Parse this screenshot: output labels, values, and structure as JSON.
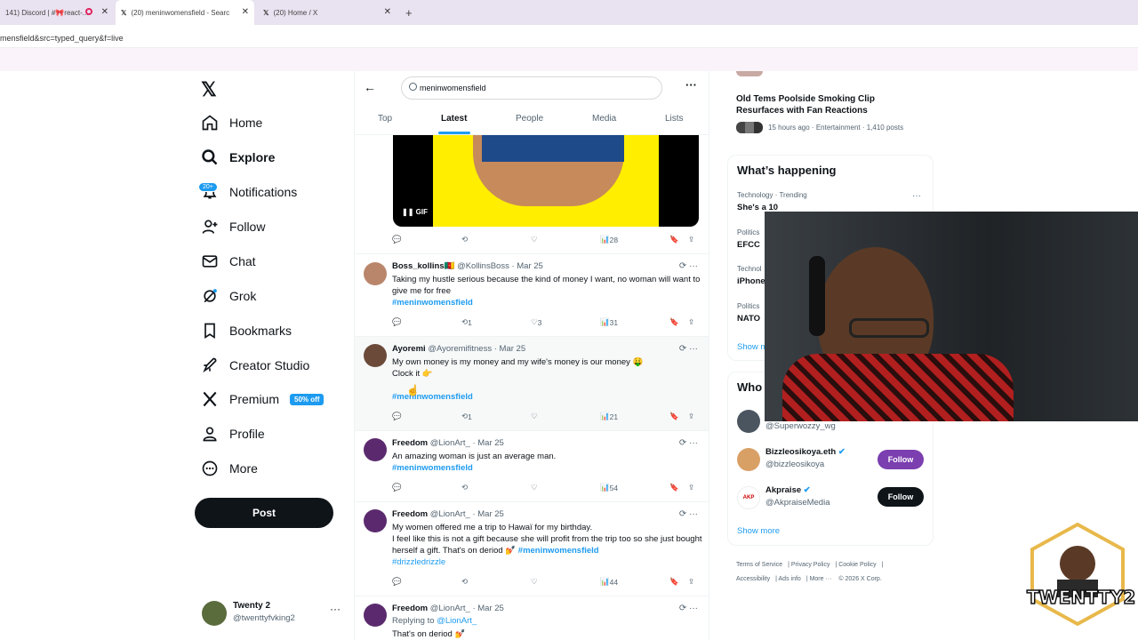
{
  "browser": {
    "tabs": [
      {
        "title": "141) Discord | #🎀react-..."
      },
      {
        "title": "(20) meninwomensfield - Searc"
      },
      {
        "title": "(20) Home / X"
      }
    ],
    "address": "mensfield&src=typed_query&f=live"
  },
  "sidebar": {
    "items": [
      {
        "label": "Home",
        "icon": "home-icon"
      },
      {
        "label": "Explore",
        "icon": "search-icon"
      },
      {
        "label": "Notifications",
        "icon": "bell-icon"
      },
      {
        "label": "Follow",
        "icon": "add-person-icon"
      },
      {
        "label": "Chat",
        "icon": "mail-icon"
      },
      {
        "label": "Grok",
        "icon": "grok-icon"
      },
      {
        "label": "Bookmarks",
        "icon": "bookmark-icon"
      },
      {
        "label": "Creator Studio",
        "icon": "rocket-icon"
      },
      {
        "label": "Premium",
        "icon": "x-logo-icon"
      },
      {
        "label": "Profile",
        "icon": "person-icon"
      },
      {
        "label": "More",
        "icon": "more-circle-icon"
      }
    ],
    "notifications_badge": "20+",
    "premium_badge": "50% off",
    "post_label": "Post",
    "account": {
      "name": "Twenty 2",
      "handle": "@twenttyfvking2"
    }
  },
  "search": {
    "query": "meninwomensfield",
    "tabs": [
      "Top",
      "Latest",
      "People",
      "Media",
      "Lists"
    ],
    "active_tab": "Latest"
  },
  "media": {
    "gif_label": "GIF"
  },
  "top_actions": {
    "views": "28"
  },
  "tweets": [
    {
      "name": "Boss_kollins🇨🇲",
      "handle": "@KollinsBoss",
      "date": "· Mar 25",
      "text": "Taking my hustle serious because the kind of money I want, no woman will want to give me for free",
      "tag": "#meninwomensfield",
      "replies": "",
      "reposts": "1",
      "likes": "3",
      "views": "31"
    },
    {
      "name": "Ayoremi",
      "handle": "@Ayoremifitness",
      "date": "· Mar 25",
      "text": "My own money is my money and my wife's money is our money 🤑",
      "text2": "Clock it 👉",
      "tag": "#meninwomensfield",
      "replies": "",
      "reposts": "1",
      "likes": "",
      "views": "21"
    },
    {
      "name": "Freedom",
      "handle": "@LionArt_",
      "date": "· Mar 25",
      "text": "An amazing woman is just an average man.",
      "tag": "#meninwomensfield",
      "replies": "",
      "reposts": "",
      "likes": "",
      "views": "54"
    },
    {
      "name": "Freedom",
      "handle": "@LionArt_",
      "date": "· Mar 25",
      "text": "My women offered me a trip to Hawaï for my birthday.",
      "text2": "I feel like this is not a gift because she will profit from the trip too so she just bought herself a gift. That's on deriod 💅",
      "tag": "#meninwomensfield",
      "tag2": "#drizzledrizzle",
      "replies": "",
      "reposts": "",
      "likes": "",
      "views": "44"
    },
    {
      "name": "Freedom",
      "handle": "@LionArt_",
      "date": "· Mar 25",
      "replying_prefix": "Replying to ",
      "replying_to": "@LionArt_",
      "text": "That's on deriod 💅"
    }
  ],
  "trending_top": {
    "title": "Old Tems Poolside Smoking Clip Resurfaces with Fan Reactions",
    "meta": "15 hours ago · Entertainment · 1,410 posts"
  },
  "whats_happening": {
    "heading": "What’s happening",
    "items": [
      {
        "context": "Technology · Trending",
        "title": "She's a 10"
      },
      {
        "context": "Politics",
        "title": "EFCC"
      },
      {
        "context": "Technol",
        "title": "iPhone"
      },
      {
        "context": "Politics",
        "title": "NATO"
      }
    ],
    "show_more": "Show m"
  },
  "who_to_follow": {
    "heading": "Who",
    "users": [
      {
        "name": "",
        "handle": "@Superwozzy_wg",
        "button": ""
      },
      {
        "name": "Bizzleosikoya.eth",
        "handle": "@bizzleosikoya",
        "button": "Follow"
      },
      {
        "name": "Akpraise",
        "handle": "@AkpraiseMedia",
        "button": "Follow"
      }
    ],
    "show_more": "Show more"
  },
  "footer": {
    "links": [
      "Terms of Service",
      "Privacy Policy",
      "Cookie Policy",
      "Accessibility",
      "Ads info",
      "More ···",
      "© 2026 X Corp."
    ]
  },
  "overlay": {
    "logo_text": "TWENTTY2"
  },
  "colors": {
    "accent": "#1d9bf0",
    "text": "#0f1419",
    "muted": "#536471"
  }
}
